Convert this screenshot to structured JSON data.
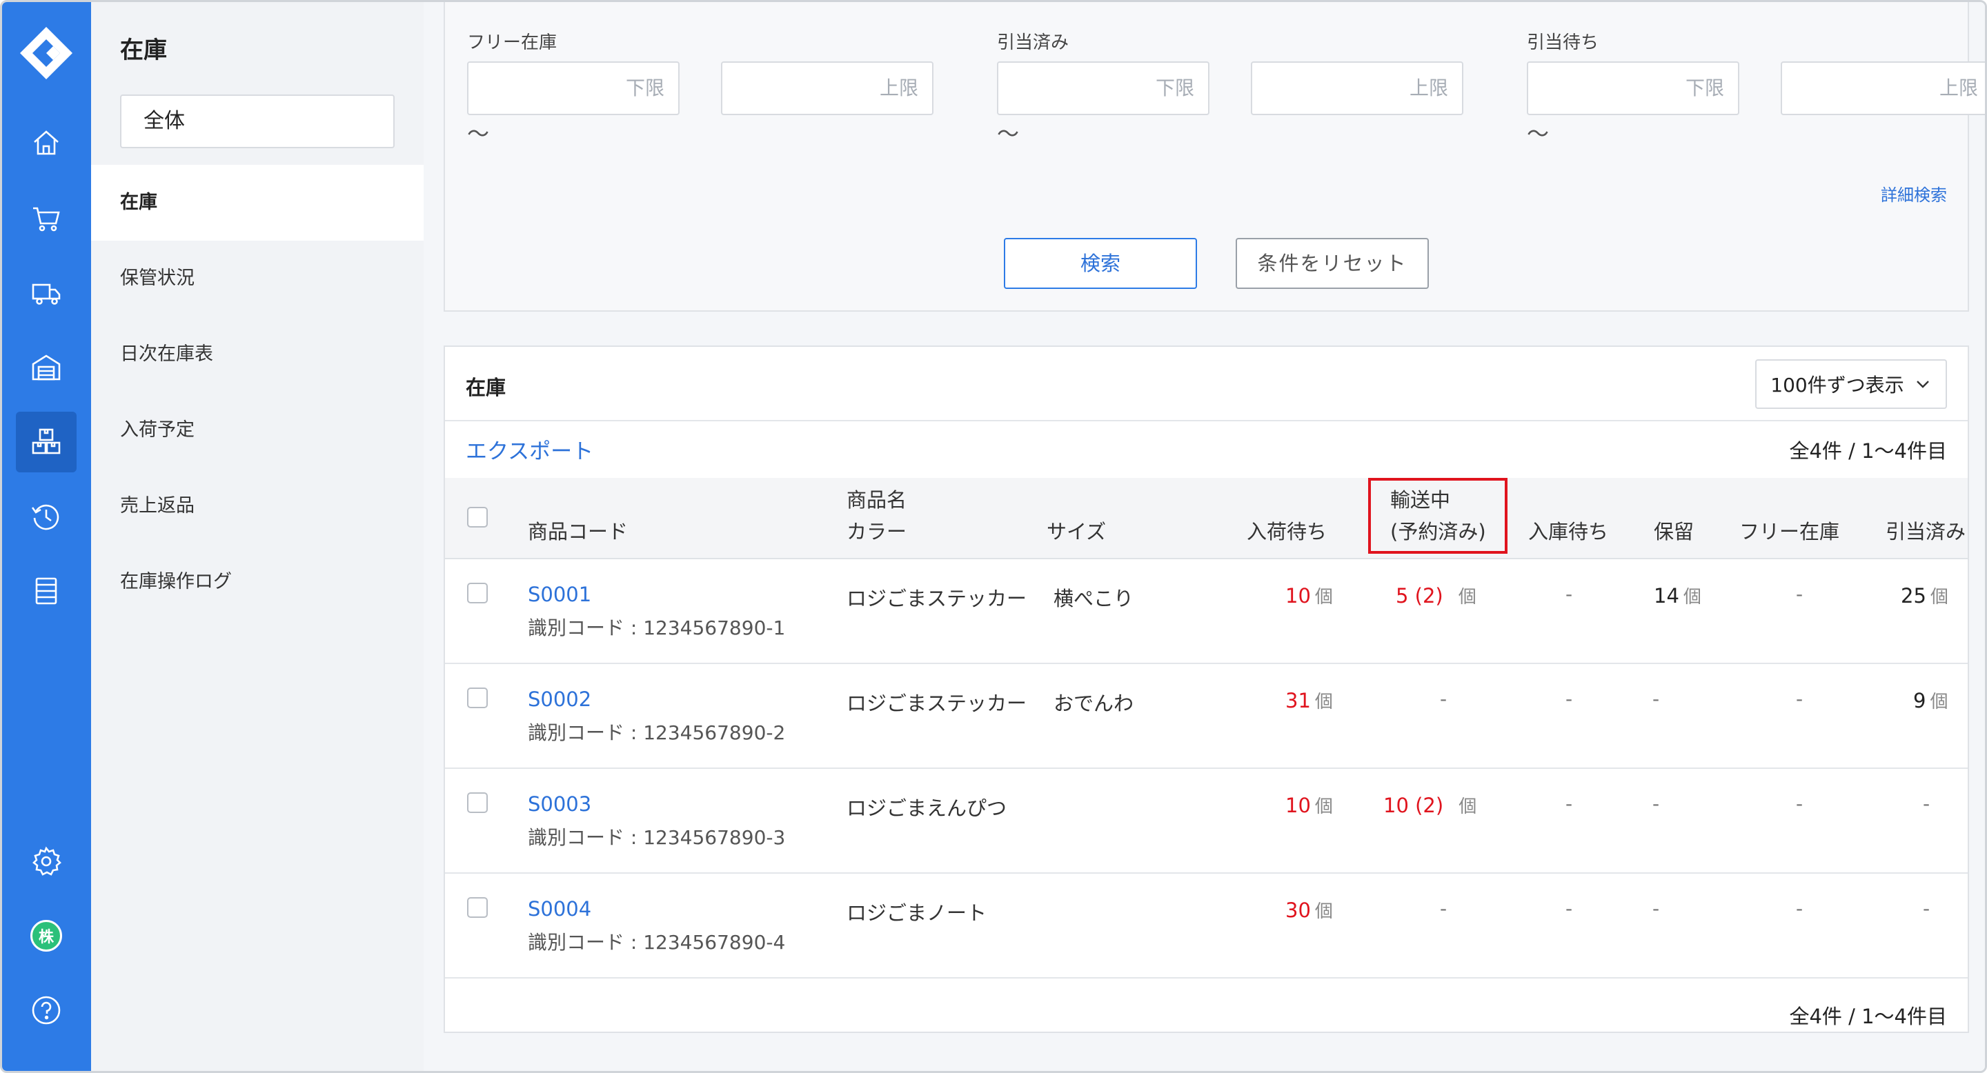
{
  "subnav": {
    "title": "在庫",
    "scope": "全体",
    "items": [
      "在庫",
      "保管状況",
      "日次在庫表",
      "入荷予定",
      "売上返品",
      "在庫操作ログ"
    ]
  },
  "filters": {
    "groups": [
      {
        "label": "フリー在庫",
        "lower": "下限",
        "upper": "上限",
        "tilde": "〜"
      },
      {
        "label": "引当済み",
        "lower": "下限",
        "upper": "上限",
        "tilde": "〜"
      },
      {
        "label": "引当待ち",
        "lower": "下限",
        "upper": "上限",
        "tilde": "〜"
      }
    ],
    "advanced_link": "詳細検索",
    "search_button": "検索",
    "reset_button": "条件をリセット"
  },
  "table": {
    "title": "在庫",
    "per_page": "100件ずつ表示",
    "export": "エクスポート",
    "count_top": "全4件 / 1〜4件目",
    "count_bottom": "全4件 / 1〜4件目",
    "headers": {
      "code": "商品コード",
      "name_line1": "商品名",
      "name_line2": "カラー",
      "size": "サイズ",
      "incoming": "入荷待ち",
      "transit_line1": "輸送中",
      "transit_line2": "(予約済み)",
      "awaiting": "入庫待ち",
      "hold": "保留",
      "free": "フリー在庫",
      "allocated": "引当済み"
    },
    "unit": "個",
    "dash": "-",
    "rows": [
      {
        "code": "S0001",
        "ident": "識別コード : 1234567890-1",
        "name": "ロジごまステッカー",
        "size": "横ぺこり",
        "incoming": "10",
        "transit": "5 (2)",
        "hold": "14",
        "allocated": "25"
      },
      {
        "code": "S0002",
        "ident": "識別コード : 1234567890-2",
        "name": "ロジごまステッカー",
        "size": "おでんわ",
        "incoming": "31",
        "allocated": "9"
      },
      {
        "code": "S0003",
        "ident": "識別コード : 1234567890-3",
        "name": "ロジごまえんぴつ",
        "incoming": "10",
        "transit": "10 (2)"
      },
      {
        "code": "S0004",
        "ident": "識別コード : 1234567890-4",
        "name": "ロジごまノート",
        "incoming": "30"
      }
    ]
  },
  "rail": {
    "icons": [
      "logo-icon",
      "home-icon",
      "cart-icon",
      "truck-icon",
      "warehouse-icon",
      "inventory-icon",
      "history-icon",
      "list-icon",
      "gear-icon",
      "company-avatar",
      "help-icon"
    ],
    "avatar_text": "株",
    "brand_color": "#2d7be6"
  }
}
